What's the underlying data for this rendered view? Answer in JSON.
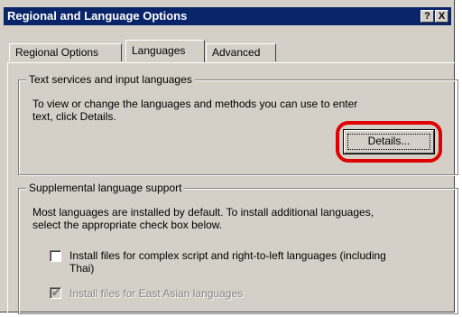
{
  "window": {
    "title": "Regional and Language Options"
  },
  "titlebar": {
    "help_label": "?",
    "close_label": "X"
  },
  "tabs": [
    {
      "label": "Regional Options"
    },
    {
      "label": "Languages"
    },
    {
      "label": "Advanced"
    }
  ],
  "active_tab": "Languages",
  "text_services": {
    "title": "Text services and input languages",
    "description_line1": "To view or change the languages and methods you can use to enter",
    "description_line2": "text, click Details.",
    "details_button": "Details..."
  },
  "supplemental": {
    "title": "Supplemental language support",
    "description_line1": "Most languages are installed by default. To install additional languages,",
    "description_line2": "select the appropriate check box below.",
    "complex_script": {
      "label_line1": "Install files for complex script and right-to-left languages (including",
      "label_line2": "Thai)",
      "checked": false,
      "enabled": true
    },
    "east_asian": {
      "label": "Install files for East Asian languages",
      "checked": true,
      "enabled": false
    }
  },
  "colors": {
    "titlebar": "#0a246a",
    "face": "#d4d0c8",
    "highlight_ring": "#e00000"
  }
}
